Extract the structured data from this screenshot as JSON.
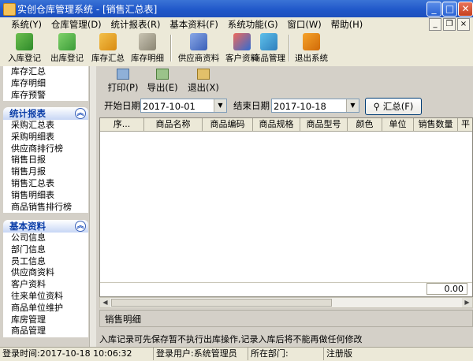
{
  "window": {
    "title": "实创仓库管理系统 - [销售汇总表]"
  },
  "menu": [
    "系统(Y)",
    "仓库管理(D)",
    "统计报表(R)",
    "基本资料(F)",
    "系统功能(G)",
    "窗口(W)",
    "帮助(H)"
  ],
  "toolbar": {
    "stock_in": "入库登记",
    "stock_out": "出库登记",
    "inventory_summary": "库存汇总",
    "inventory_detail": "库存明细",
    "supplier_info": "供应商资料",
    "customer_info": "客户资料",
    "goods_manage": "商品管理",
    "exit_system": "退出系统"
  },
  "sidebar": {
    "top_items": [
      "库存汇总",
      "库存明细",
      "库存预警"
    ],
    "stats_header": "统计报表",
    "stats_items": [
      "采购汇总表",
      "采购明细表",
      "供应商排行榜",
      "销售日报",
      "销售月报",
      "销售汇总表",
      "销售明细表",
      "商品销售排行榜"
    ],
    "basic_header": "基本资料",
    "basic_items": [
      "公司信息",
      "部门信息",
      "员工信息",
      "供应商资料",
      "客户资料",
      "往来单位资料",
      "商品单位维护",
      "库房管理",
      "商品管理"
    ]
  },
  "subtoolbar": {
    "print": "打印(P)",
    "export": "导出(E)",
    "exit": "退出(X)"
  },
  "filter": {
    "start_label": "开始日期",
    "start_date": "2017-10-01",
    "end_label": "结束日期",
    "end_date": "2017-10-18",
    "summary_button": "汇总(F)"
  },
  "grid": {
    "columns": [
      "序...",
      "商品名称",
      "商品编码",
      "商品规格",
      "商品型号",
      "颜色",
      "单位",
      "销售数量",
      "平"
    ],
    "rows": [],
    "total": "0.00"
  },
  "detail_tab": "销售明细",
  "notice": "入库记录可先保存暂不执行出库操作,记录入库后将不能再做任何修改",
  "statusbar": {
    "login_time_label": "登录时间:",
    "login_time": "2017-10-18 10:06:32",
    "user_label": "登录用户:",
    "user": "系统管理员",
    "dept_label": "所在部门:",
    "dept": "",
    "reg": "注册版"
  },
  "colors": {
    "title_bar": "#1f56c8",
    "section_header": "#0b3ea8",
    "background": "#d4d0c8"
  }
}
